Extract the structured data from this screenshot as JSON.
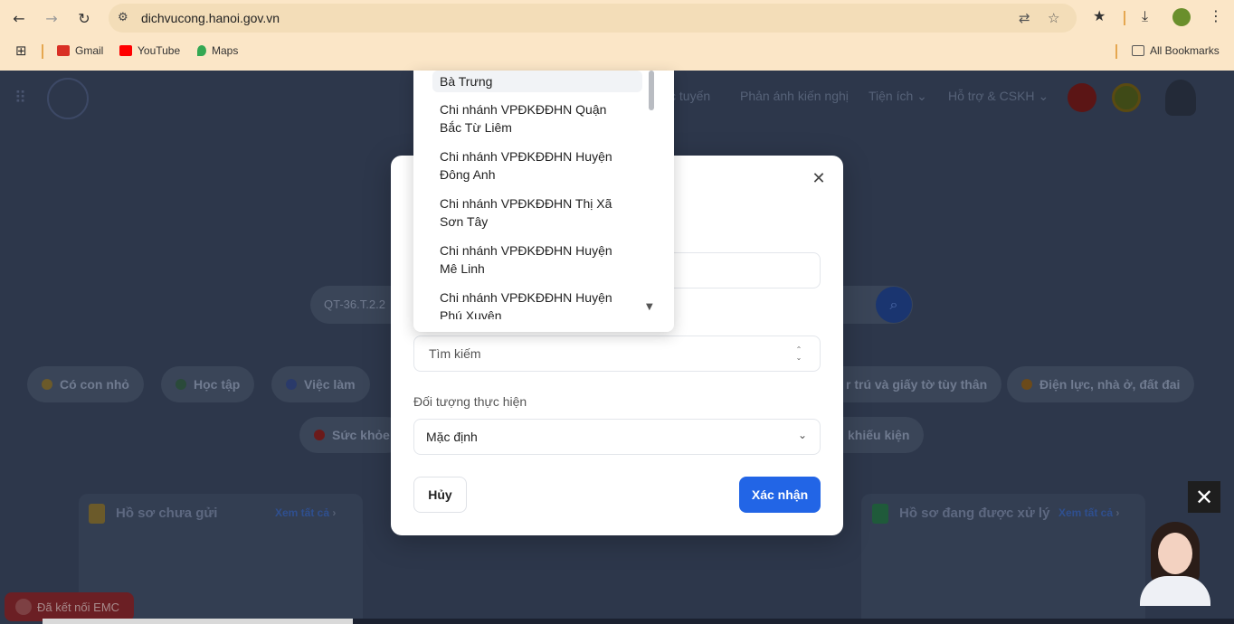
{
  "browser": {
    "url": "dichvucong.hanoi.gov.vn",
    "bookmarks": [
      {
        "label": "Gmail",
        "color": "#d93025"
      },
      {
        "label": "YouTube",
        "color": "#ff0000"
      },
      {
        "label": "Maps",
        "color": "#34a853"
      }
    ],
    "all_bookmarks": "All Bookmarks"
  },
  "page": {
    "nav": [
      {
        "label": "c tuyến"
      },
      {
        "label": "Phản ánh kiến nghị"
      },
      {
        "label": "Tiện ích"
      },
      {
        "label": "Hỗ trợ & CSKH"
      }
    ],
    "search_text": "QT-36.T.2.2",
    "chips_row1": [
      {
        "label": "Có con nhỏ"
      },
      {
        "label": "Học tập"
      },
      {
        "label": "Việc làm"
      },
      {
        "label": "r trú và giấy tờ tùy thân"
      },
      {
        "label": "Điện lực, nhà ở, đất đai"
      }
    ],
    "chips_row2": [
      {
        "label": "Sức khỏe"
      },
      {
        "label": "khiếu kiện"
      }
    ],
    "cards": [
      {
        "title": "Hồ sơ chưa gửi",
        "link": "Xem tất cả"
      },
      {
        "title": "Hồ sơ đang được xử lý",
        "link": "Xem tất cả"
      }
    ],
    "emc_label": "Đã kết nối EMC"
  },
  "dropdown": {
    "items": [
      {
        "line1": "Bà Trưng",
        "line2": ""
      },
      {
        "line1": "Chi nhánh VPĐKĐĐHN Quận",
        "line2": "Bắc Từ Liêm"
      },
      {
        "line1": "Chi nhánh VPĐKĐĐHN Huyện",
        "line2": "Đông Anh"
      },
      {
        "line1": "Chi nhánh VPĐKĐĐHN Thị Xã",
        "line2": "Sơn Tây"
      },
      {
        "line1": "Chi nhánh VPĐKĐĐHN Huyện",
        "line2": "Mê Linh"
      },
      {
        "line1": "Chi nhánh VPĐKĐĐHN Huyện",
        "line2": "Phú Xuyên"
      }
    ]
  },
  "modal": {
    "search_placeholder": "Tìm kiếm",
    "target_label": "Đối tượng thực hiện",
    "target_value": "Mặc định",
    "cancel_label": "Hủy",
    "confirm_label": "Xác nhận"
  },
  "colors": {
    "primary": "#2265e6",
    "chrome": "#fbe6c7"
  }
}
